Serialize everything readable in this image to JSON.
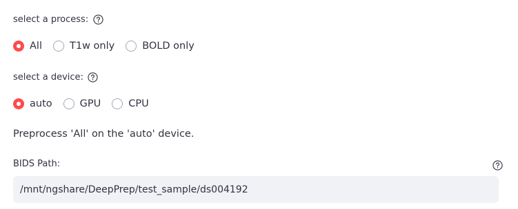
{
  "process": {
    "label": "select a process:",
    "help_icon": "question-circle-icon",
    "options": [
      "All",
      "T1w only",
      "BOLD only"
    ],
    "selected": "All"
  },
  "device": {
    "label": "select a device:",
    "help_icon": "question-circle-icon",
    "options": [
      "auto",
      "GPU",
      "CPU"
    ],
    "selected": "auto"
  },
  "summary": {
    "text": "Preprocess 'All' on the 'auto' device."
  },
  "bids": {
    "label": "BIDS Path:",
    "help_icon": "question-circle-icon",
    "value": "/mnt/ngshare/DeepPrep/test_sample/ds004192"
  },
  "colors": {
    "accent": "#ff4b4b",
    "text": "#31333f",
    "input_bg": "#f0f2f6",
    "radio_border": "#a3a8b8"
  }
}
